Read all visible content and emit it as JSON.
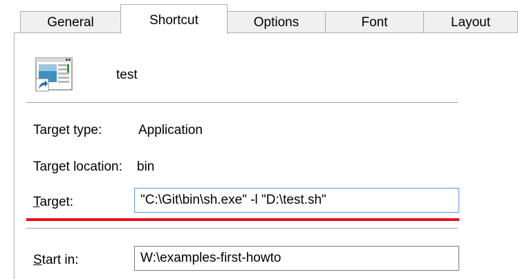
{
  "tabs": [
    {
      "label": "General"
    },
    {
      "label": "Shortcut",
      "active": true
    },
    {
      "label": "Options"
    },
    {
      "label": "Font"
    },
    {
      "label": "Layout"
    }
  ],
  "shortcut": {
    "name": "test",
    "target_type_label": "Target type:",
    "target_type_value": "Application",
    "target_location_label": "Target location:",
    "target_location_value": "bin",
    "target_label_first": "T",
    "target_label_rest": "arget:",
    "target_value": "\"C:\\Git\\bin\\sh.exe\" -l \"D:\\test.sh\"",
    "start_in_label_first": "S",
    "start_in_label_rest": "tart in:",
    "start_in_value": "W:\\examples-first-howto"
  },
  "colors": {
    "highlight_line": "#e8101c",
    "focus_border": "#569de5"
  },
  "icons": {
    "app_icon": "shortcut-application-icon"
  }
}
